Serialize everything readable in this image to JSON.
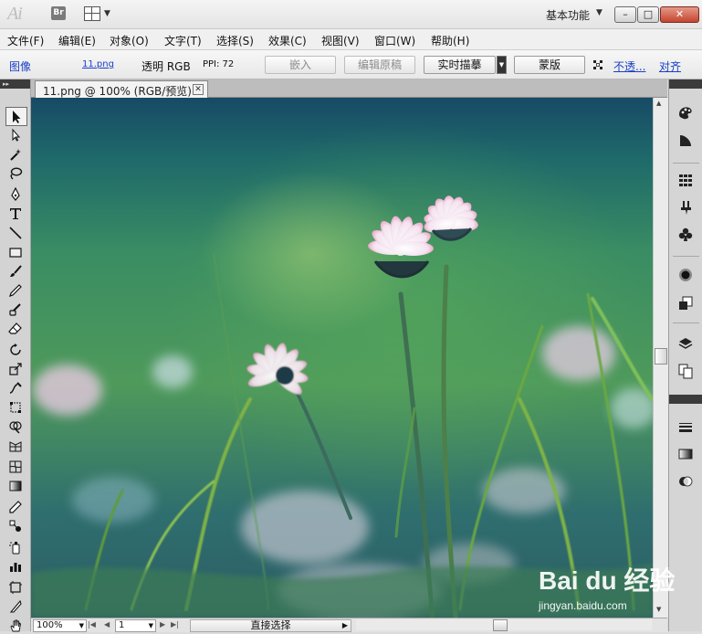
{
  "app": {
    "logo_text": "Ai",
    "bridge_label": "Br",
    "workspace": "基本功能",
    "window_buttons": {
      "minimize": "–",
      "maximize": "□",
      "close": "✕"
    }
  },
  "menu": [
    "文件(F)",
    "编辑(E)",
    "对象(O)",
    "文字(T)",
    "选择(S)",
    "效果(C)",
    "视图(V)",
    "窗口(W)",
    "帮助(H)"
  ],
  "control_bar": {
    "object_type": "图像",
    "filename": "11.png",
    "mode": "透明 RGB",
    "ppi": "PPI: 72",
    "embed": "嵌入",
    "edit_original": "编辑原稿",
    "live_trace": "实时描摹",
    "mask": "蒙版",
    "opacity": "不透...",
    "align": "对齐"
  },
  "document": {
    "tab_title": "11.png @ 100% (RGB/预览)"
  },
  "status_bar": {
    "zoom": "100%",
    "artboard": "1",
    "status": "直接选择"
  },
  "tools": [
    "selection-tool",
    "direct-selection-tool",
    "magic-wand-tool",
    "lasso-tool",
    "pen-tool",
    "type-tool",
    "line-segment-tool",
    "rectangle-tool",
    "paintbrush-tool",
    "pencil-tool",
    "blob-brush-tool",
    "eraser-tool",
    "rotate-tool",
    "scale-tool",
    "warp-tool",
    "free-transform-tool",
    "shape-builder-tool",
    "perspective-grid-tool",
    "mesh-tool",
    "gradient-tool",
    "eyedropper-tool",
    "blend-tool",
    "symbol-sprayer-tool",
    "column-graph-tool",
    "artboard-tool",
    "slice-tool",
    "hand-tool"
  ],
  "right_panel": [
    "color-icon",
    "color-guide-icon",
    "swatches-icon",
    "brushes-icon",
    "symbols-icon",
    "appearance-icon",
    "graphic-styles-icon",
    "layers-icon",
    "artboards-icon",
    "stroke-icon",
    "gradient-icon",
    "transparency-icon"
  ],
  "watermark": {
    "logo": "Bai du 经验",
    "url": "jingyan.baidu.com"
  },
  "colors": {
    "link": "#1a3fc7",
    "close_button": "#c4452f",
    "canvas_top": "#174a66",
    "canvas_mid": "#4f9a5b"
  }
}
